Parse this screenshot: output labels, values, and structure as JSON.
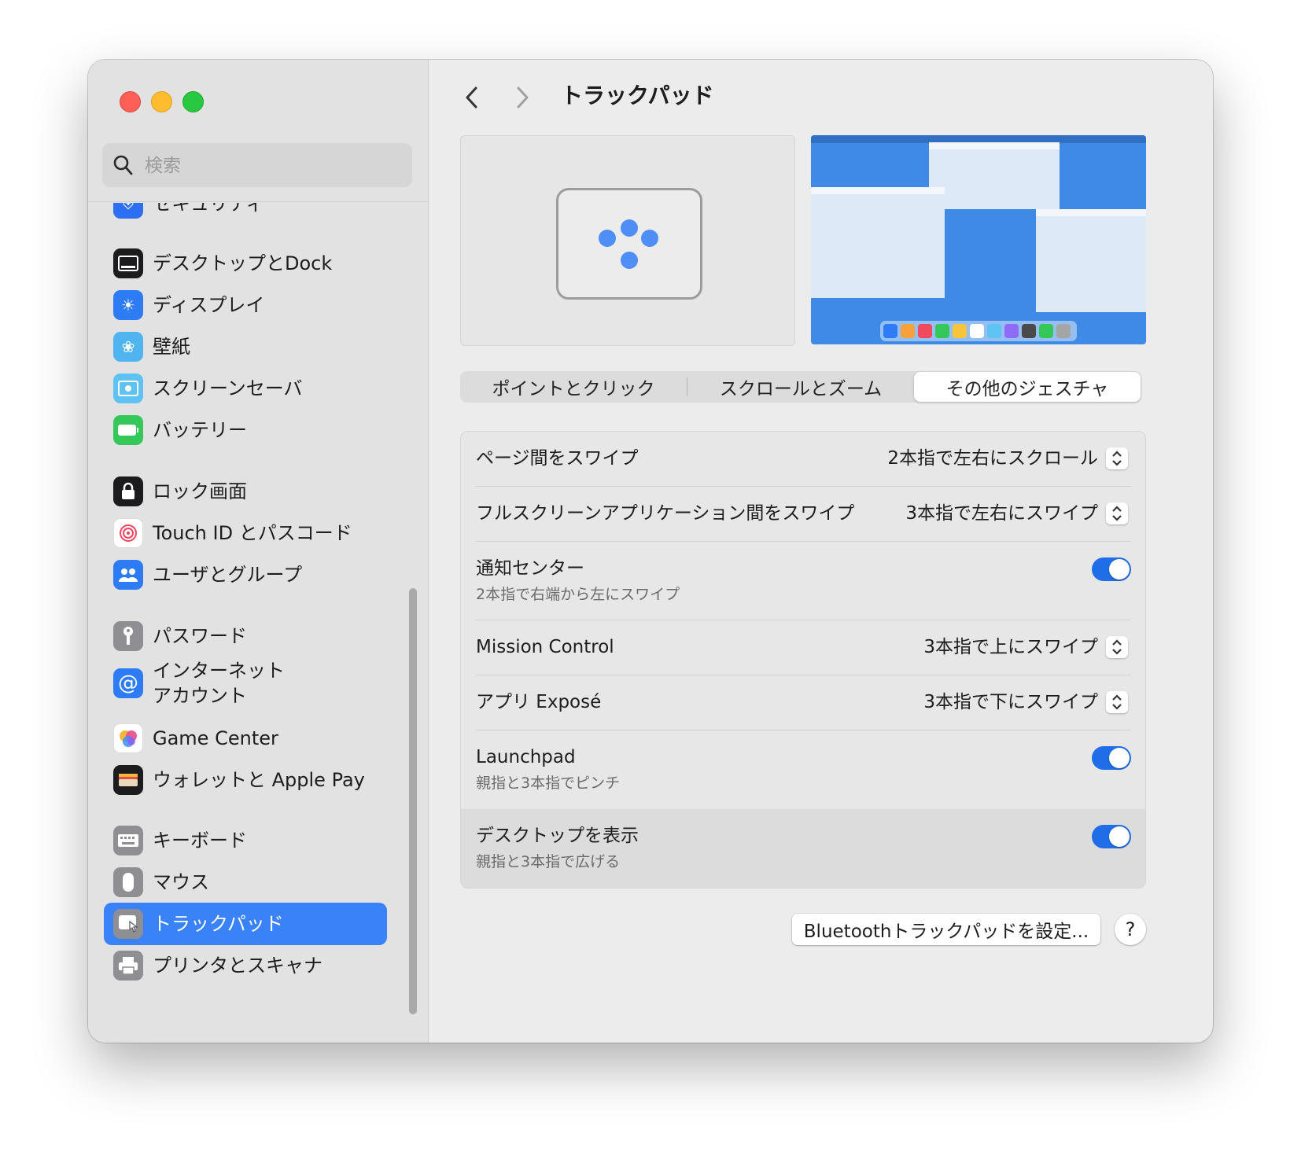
{
  "window": {
    "title": "トラックパッド",
    "traffic_lights": [
      "close",
      "minimize",
      "zoom"
    ]
  },
  "search": {
    "placeholder": "検索"
  },
  "sidebar": {
    "items": [
      {
        "label": "セキュリティ",
        "icon": "shield-icon",
        "color": "#2d6ff2"
      },
      {
        "label": "デスクトップとDock",
        "icon": "dock-icon",
        "color": "#1c1c1e"
      },
      {
        "label": "ディスプレイ",
        "icon": "sun-icon",
        "color": "#2d7cf6"
      },
      {
        "label": "壁紙",
        "icon": "flower-icon",
        "color": "#4fb4f0"
      },
      {
        "label": "スクリーンセーバ",
        "icon": "screensaver-icon",
        "color": "#5ec2f2"
      },
      {
        "label": "バッテリー",
        "icon": "battery-icon",
        "color": "#34c759"
      },
      {
        "label": "ロック画面",
        "icon": "lock-icon",
        "color": "#1c1c1e"
      },
      {
        "label": "Touch ID とパスコード",
        "icon": "fingerprint-icon",
        "color": "#ffffff"
      },
      {
        "label": "ユーザとグループ",
        "icon": "users-icon",
        "color": "#2d7cf6"
      },
      {
        "label": "パスワード",
        "icon": "key-icon",
        "color": "#8e8e93"
      },
      {
        "label": "インターネット\nアカウント",
        "icon": "at-icon",
        "color": "#2d7cf6"
      },
      {
        "label": "Game Center",
        "icon": "game-center-icon",
        "color": "#ffffff"
      },
      {
        "label": "ウォレットと Apple Pay",
        "icon": "wallet-icon",
        "color": "#1c1c1e"
      },
      {
        "label": "キーボード",
        "icon": "keyboard-icon",
        "color": "#8e8e93"
      },
      {
        "label": "マウス",
        "icon": "mouse-icon",
        "color": "#8e8e93"
      },
      {
        "label": "トラックパッド",
        "icon": "trackpad-icon",
        "color": "#8e8e93",
        "selected": true
      },
      {
        "label": "プリンタとスキャナ",
        "icon": "printer-icon",
        "color": "#8e8e93"
      }
    ]
  },
  "main": {
    "title": "トラックパッド",
    "tabs": [
      {
        "label": "ポイントとクリック",
        "active": false
      },
      {
        "label": "スクロールとズーム",
        "active": false
      },
      {
        "label": "その他のジェスチャ",
        "active": true
      }
    ],
    "rows": [
      {
        "title": "ページ間をスワイプ",
        "value": "2本指で左右にスクロール",
        "control": "popup"
      },
      {
        "title": "フルスクリーンアプリケーション間をスワイプ",
        "value": "3本指で左右にスワイプ",
        "control": "popup"
      },
      {
        "title": "通知センター",
        "subtitle": "2本指で右端から左にスワイプ",
        "control": "toggle",
        "on": true
      },
      {
        "title": "Mission Control",
        "value": "3本指で上にスワイプ",
        "control": "popup"
      },
      {
        "title": "アプリ Exposé",
        "value": "3本指で下にスワイプ",
        "control": "popup"
      },
      {
        "title": "Launchpad",
        "subtitle": "親指と3本指でピンチ",
        "control": "toggle",
        "on": true
      },
      {
        "title": "デスクトップを表示",
        "subtitle": "親指と3本指で広げる",
        "control": "toggle",
        "on": true
      }
    ],
    "bluetooth_button": "Bluetoothトラックパッドを設定...",
    "help_button": "?"
  },
  "colors": {
    "accent": "#3a82f7",
    "toggle_on": "#1f6ee8",
    "preview_desktop": "#3f8ae6"
  }
}
